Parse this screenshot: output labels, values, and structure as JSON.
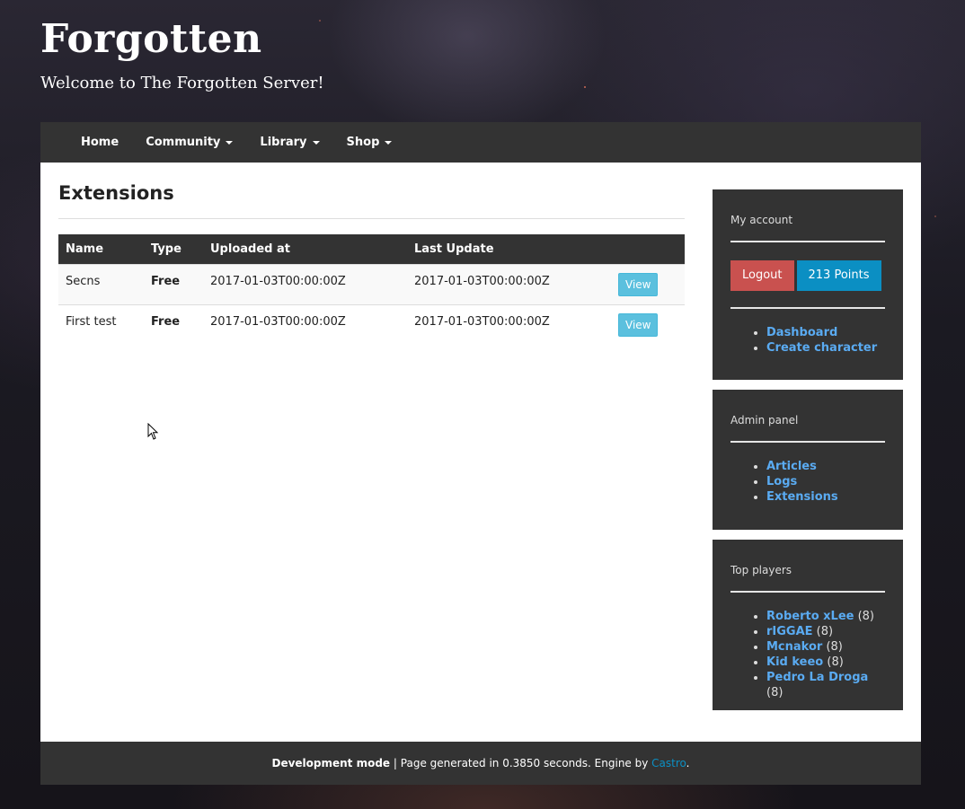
{
  "site": {
    "title": "Forgotten",
    "tagline": "Welcome to The Forgotten Server!"
  },
  "nav": {
    "items": [
      {
        "label": "Home",
        "dropdown": false
      },
      {
        "label": "Community",
        "dropdown": true
      },
      {
        "label": "Library",
        "dropdown": true
      },
      {
        "label": "Shop",
        "dropdown": true
      }
    ]
  },
  "main": {
    "title": "Extensions",
    "table": {
      "columns": [
        "Name",
        "Type",
        "Uploaded at",
        "Last Update",
        ""
      ],
      "rows": [
        {
          "name": "Secns",
          "type": "Free",
          "uploaded": "2017-01-03T00:00:00Z",
          "updated": "2017-01-03T00:00:00Z",
          "action": "View"
        },
        {
          "name": "First test",
          "type": "Free",
          "uploaded": "2017-01-03T00:00:00Z",
          "updated": "2017-01-03T00:00:00Z",
          "action": "View"
        }
      ]
    }
  },
  "sidebar": {
    "account": {
      "title": "My account",
      "logout_label": "Logout",
      "points_label": "213 Points",
      "links": [
        "Dashboard",
        "Create character"
      ]
    },
    "admin": {
      "title": "Admin panel",
      "links": [
        "Articles",
        "Logs",
        "Extensions"
      ]
    },
    "top_players": {
      "title": "Top players",
      "players": [
        {
          "name": "Roberto xLee",
          "level": "(8)"
        },
        {
          "name": "rIGGAE",
          "level": "(8)"
        },
        {
          "name": "Mcnakor",
          "level": "(8)"
        },
        {
          "name": "Kid keeo",
          "level": "(8)"
        },
        {
          "name": "Pedro La Droga",
          "level": "(8)"
        }
      ]
    }
  },
  "footer": {
    "mode": "Development mode",
    "separator": "|",
    "generated": "Page generated in 0.3850 seconds. Engine by",
    "engine_link": "Castro",
    "end": "."
  },
  "colors": {
    "panel_dark": "#333333",
    "link_blue": "#5aabf2",
    "logout_red": "#c9514f",
    "points_blue": "#0b8fc3",
    "view_button": "#5bc0de"
  }
}
